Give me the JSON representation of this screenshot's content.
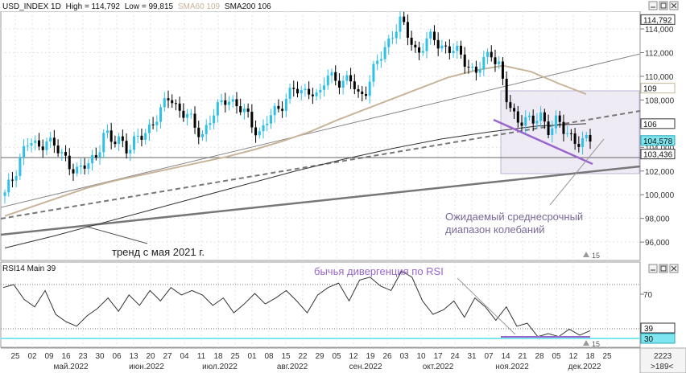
{
  "header": {
    "symbol": "USD_INDEX 1D",
    "high_text": "High = 114,792",
    "low_text": "Low = 99,815",
    "sma60_text": "SMA60 109",
    "sma200_text": "SMA200 106"
  },
  "colors": {
    "candle_up": "#2fc0e6",
    "candle_down": "#000000",
    "sma60": "#c8b49a",
    "sma200": "#333333",
    "trend": "#777777",
    "purple": "#9966cc",
    "annotation": "#7a6a9a",
    "box_fill": "#ece8f4",
    "cyan_badge": "#7fe6f0",
    "grid": "#e3e3e3",
    "rsi_line": "#333333"
  },
  "price_panel": {
    "y_ticks": [
      "114,000",
      "112,000",
      "110,000",
      "108,000",
      "106,000",
      "104,000",
      "102,000",
      "100,000",
      "98,000",
      "96,000"
    ],
    "badges": {
      "high": "114,792",
      "sma60": "109",
      "sma200": "106",
      "current": "104,578",
      "level": "103,436"
    },
    "annotations": {
      "range_line1": "Ожидаемый среднесрочный",
      "range_line2": "диапазон колебаний",
      "trend": "тренд с мая 2021 г."
    },
    "scale_marker": "15"
  },
  "rsi_panel": {
    "title": "RSI14 Main 39",
    "levels": [
      "70",
      "30"
    ],
    "current": "39",
    "annotation": "бычья дивергенция по RSI",
    "scale_marker": "15"
  },
  "x_axis": {
    "days": [
      "25",
      "02",
      "09",
      "16",
      "23",
      "30",
      "06",
      "13",
      "20",
      "27",
      "04",
      "11",
      "18",
      "25",
      "01",
      "08",
      "15",
      "22",
      "29",
      "05",
      "12",
      "19",
      "26",
      "03",
      "10",
      "17",
      "24",
      "31",
      "07",
      "14",
      "21",
      "28",
      "05",
      "12",
      "18",
      "25"
    ],
    "months": [
      "май.2022",
      "июн.2022",
      "июл.2022",
      "авг.2022",
      "сен.2022",
      "окт.2022",
      "ноя.2022",
      "дек.2022"
    ],
    "right_top": "2223",
    "right_bottom": ">189<"
  },
  "chart_data": [
    {
      "type": "candlestick",
      "title": "USD_INDEX 1D",
      "y_range": [
        95,
        115.5
      ],
      "high": 114.792,
      "low": 99.815,
      "series": [
        {
          "name": "USD_INDEX",
          "values": [
            99.9,
            101.5,
            103.5,
            104.5,
            103.8,
            104.9,
            104.0,
            103.2,
            102.6,
            101.9,
            102.5,
            103.3,
            105.2,
            104.3,
            104.8,
            103.9,
            104.5,
            105.2,
            106.3,
            107.0,
            108.4,
            107.3,
            106.8,
            105.6,
            105.2,
            106.5,
            107.3,
            108.4,
            107.6,
            106.9,
            106.0,
            105.2,
            106.4,
            107.1,
            108.2,
            108.9,
            108.4,
            109.2,
            108.0,
            109.9,
            110.1,
            109.4,
            109.6,
            108.3,
            109.2,
            110.8,
            112.3,
            113.7,
            114.5,
            113.4,
            112.0,
            112.8,
            113.2,
            112.6,
            112.3,
            111.8,
            111.3,
            110.3,
            111.0,
            112.1,
            111.0,
            107.5,
            106.2,
            106.7,
            106.0,
            106.5,
            105.7,
            106.3,
            105.0,
            104.9,
            104.4,
            104.6
          ]
        },
        {
          "name": "SMA60",
          "values": [
            98.2,
            99.0,
            99.8,
            100.6,
            101.2,
            101.7,
            102.2,
            102.7,
            103.2,
            103.8,
            104.5,
            105.3,
            106.3,
            107.2,
            108.1,
            109.0,
            109.9,
            110.5,
            110.9,
            110.4,
            109.4,
            108.5
          ]
        },
        {
          "name": "SMA200",
          "values": [
            95.5,
            96.5,
            97.6,
            98.7,
            99.8,
            100.9,
            102.0,
            103.0,
            103.9,
            104.7,
            105.3,
            105.8,
            106.0
          ]
        }
      ],
      "levels": {
        "current": 104.578,
        "support": 103.436,
        "sma60": 109,
        "sma200": 106
      },
      "range_box": [
        102,
        109
      ]
    },
    {
      "type": "line",
      "title": "RSI14 Main 39",
      "y_range": [
        0,
        100
      ],
      "levels": [
        70,
        30
      ],
      "series": [
        {
          "name": "RSI14",
          "values": [
            68,
            70,
            60,
            55,
            66,
            50,
            45,
            42,
            49,
            54,
            61,
            52,
            63,
            56,
            66,
            59,
            68,
            63,
            66,
            63,
            56,
            61,
            51,
            57,
            64,
            57,
            61,
            66,
            59,
            51,
            63,
            68,
            71,
            59,
            73,
            75,
            69,
            66,
            79,
            75,
            59,
            50,
            53,
            59,
            48,
            61,
            55,
            46,
            55,
            42,
            44,
            35,
            37,
            35,
            40,
            36,
            39
          ]
        }
      ]
    }
  ]
}
